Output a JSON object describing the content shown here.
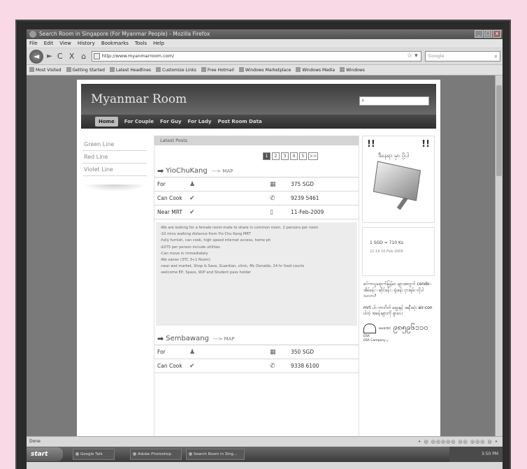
{
  "window": {
    "title": "Search Room in Singapore (For Myanmar People) - Mozilla Firefox",
    "controls": [
      "_",
      "□",
      "x"
    ]
  },
  "menu": [
    "File",
    "Edit",
    "View",
    "History",
    "Bookmarks",
    "Tools",
    "Help"
  ],
  "nav": {
    "back": "◄",
    "forward": "►",
    "reload": "C",
    "stop": "X",
    "home": "⌂",
    "url": "http://www.myanmarroom.com/",
    "search_placeholder": "Google"
  },
  "bookmarks": [
    "Most Visited",
    "Getting Started",
    "Latest Headlines",
    "Customize Links",
    "Free Hotmail",
    "Windows Marketplace",
    "Windows Media",
    "Windows"
  ],
  "site": {
    "logo": "Myanmar  Room",
    "menu": [
      "Home",
      "For Couple",
      "For Guy",
      "For Lady",
      "Post Room Data"
    ],
    "left_nav": [
      "Green Line",
      "Red Line",
      "Violet Line"
    ],
    "latest_label": "Latest Posts",
    "pager": [
      "1",
      "2",
      "3",
      "4",
      "5",
      ">>"
    ],
    "listings": [
      {
        "location": "YioChuKang",
        "map_link": "---> MAP",
        "rows": [
          {
            "label": "For",
            "value": "375 SGD"
          },
          {
            "label": "Can Cook",
            "value": "9239 5461"
          },
          {
            "label": "Near MRT",
            "value": "11-Feb-2009"
          }
        ],
        "description": [
          "-We are looking for a female room-mate to share in common room. 2 persons per room",
          "-10 mins walking distance from Yio Chu Kang MRT",
          "-fully furnish, can cook, high speed internet access, home ph",
          "-$375 per person include utilities",
          "-Can move in immediately",
          "-We owner (3TC 3+1 Room)",
          "-near wet market, Shop & Save, Guardian, clinic, Mc Donalds, 24 hr food courts",
          "-welcome EP, Spass, W/P and Student pass holder"
        ]
      },
      {
        "location": "Sembawang",
        "map_link": "---> MAP",
        "rows": [
          {
            "label": "For",
            "value": "350 SGD"
          },
          {
            "label": "Can Cook",
            "value": "9338 6100"
          }
        ]
      }
    ],
    "sidebar": {
      "exclaim": "!!",
      "ad_text": "ဒီနေရာ မှာ ပို့ပါ",
      "rate": "1 SGD = 710 Ks",
      "rate_time": "22:19 10-Feb-2009",
      "myanmar_text_1": "စင်ကာပူရောက်မြန်မာ များအတွက် condo ၊ အိမ်ခန်း ၊ ဆိုင်ခန်း ၊ ရုံးခန်း ငှားရမ်း လိုပါသလား?",
      "myanmar_text_2": "mrt ပါး ကားဂိတ် ဈေးနှင့် အနီးဆုံး air-con ပါတဲ့ အခန်းများကို ရှာပေး",
      "era_mm": "မမအေး",
      "era_phone": "၉၈၅၉၆၁၁၀",
      "era_logo": "ERA",
      "era_company": "ERA Company မှ"
    }
  },
  "status": {
    "text": "Done",
    "right": "• ◎ ◎◎◎◎◎ ◎◎ ◎◎◎ ◎ •"
  },
  "taskbar": {
    "start": "start",
    "tasks": [
      "Google Talk",
      "Adobe Photoshop",
      "Search Room in Sing..."
    ],
    "clock": "3:50 PM"
  }
}
